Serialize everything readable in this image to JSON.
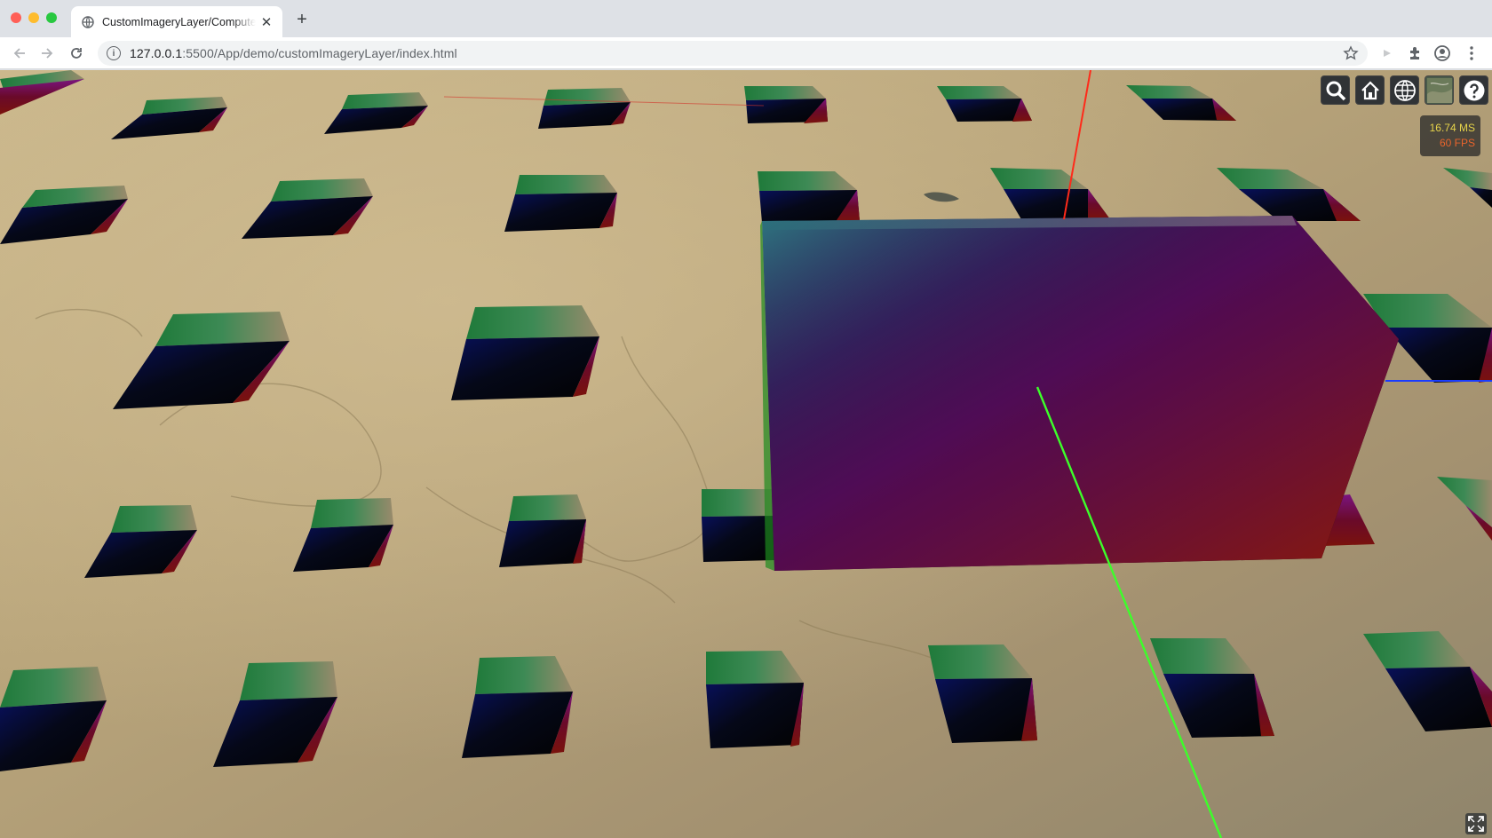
{
  "window": {
    "traffic_lights": [
      "#ff5f57",
      "#febc2e",
      "#28c840"
    ]
  },
  "tab": {
    "title": "CustomImageryLayer/ComputeShader",
    "favicon": "globe-icon",
    "close_icon": "close-icon"
  },
  "new_tab_icon": "plus-icon",
  "address_bar": {
    "url_host": "127.0.0.1",
    "url_rest": ":5500/App/demo/customImageryLayer/index.html",
    "security_icon": "info-icon"
  },
  "toolbar_icons": [
    "back-icon",
    "forward-icon",
    "reload-icon",
    "bookmark-star-icon",
    "media-icon",
    "extensions-icon",
    "profile-icon",
    "menu-icon"
  ],
  "cesium_toolbar": {
    "buttons": [
      "search-icon",
      "home-icon",
      "globe-icon",
      "imagery-layer-icon",
      "help-icon"
    ]
  },
  "performance": {
    "ms": "16.74 MS",
    "fps": "60 FPS",
    "ms_color": "#e6d34a",
    "fps_color": "#e8642c"
  },
  "fullscreen_icon": "fullscreen-icon",
  "scene_colors": {
    "terrain": "#b9a67c",
    "axis_x": "#ff2a1a",
    "axis_y": "#3cff2a",
    "axis_z": "#1a3cff"
  }
}
